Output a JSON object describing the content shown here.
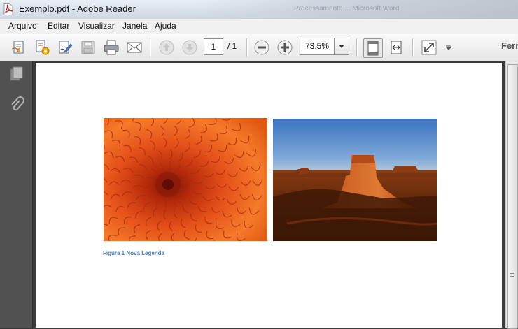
{
  "window": {
    "title": "Exemplo.pdf - Adobe Reader",
    "background_title": "Processamento ... Microsoft Word"
  },
  "menu": {
    "items": [
      "Arquivo",
      "Editar",
      "Visualizar",
      "Janela",
      "Ajuda"
    ]
  },
  "toolbar": {
    "page_current": "1",
    "page_total": "/ 1",
    "zoom": "73,5%",
    "right_label": "Ferr",
    "icons": [
      "create-pdf-icon",
      "share-icon",
      "sign-icon",
      "save-icon",
      "print-icon",
      "email-icon",
      "previous-page-icon",
      "next-page-icon",
      "zoom-out-icon",
      "zoom-in-icon",
      "fit-page-icon",
      "fit-width-icon",
      "fullscreen-icon",
      "toolbar-options-icon"
    ]
  },
  "nav": {
    "icons": [
      "pages-icon",
      "attachments-icon"
    ]
  },
  "document": {
    "images": [
      {
        "name": "flower-image",
        "description_colors": [
          "#c23a0c",
          "#f36b1e"
        ]
      },
      {
        "name": "desert-image",
        "description_colors": [
          "#4f85c6",
          "#a84a1a"
        ]
      }
    ],
    "caption": "Figura 1 Nova Legenda"
  },
  "colors": {
    "caption": "#4f81bd",
    "nav_bg": "#515151",
    "doc_bg": "#3b3b3b"
  }
}
